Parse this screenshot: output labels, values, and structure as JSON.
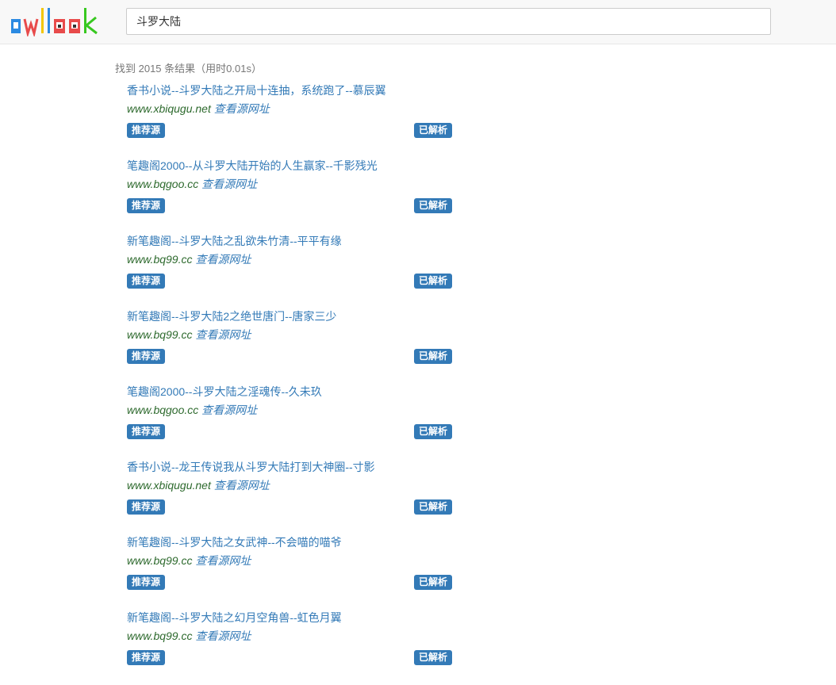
{
  "header": {
    "logo_letters": [
      "o",
      "w",
      "l",
      "l",
      "o",
      "o",
      "k"
    ],
    "logo_colors": [
      "#2b8ae2",
      "#e84b4b",
      "#f2c600",
      "#2b8ae2",
      "#e84b4b",
      "#e84b4b",
      "#38c820"
    ],
    "search_value": "斗罗大陆"
  },
  "summary": {
    "text": "找到 2015 条结果（用时0.01s）"
  },
  "results": [
    {
      "title": "香书小说--斗罗大陆之开局十连抽，系统跑了--慕辰翼",
      "domain": "www.xbiqugu.net",
      "source_link": "查看源网址",
      "badge_left": "推荐源",
      "badge_right": "已解析"
    },
    {
      "title": "笔趣阁2000--从斗罗大陆开始的人生赢家--千影残光",
      "domain": "www.bqgoo.cc",
      "source_link": "查看源网址",
      "badge_left": "推荐源",
      "badge_right": "已解析"
    },
    {
      "title": "新笔趣阁--斗罗大陆之乱欲朱竹清--平平有缘",
      "domain": "www.bq99.cc",
      "source_link": "查看源网址",
      "badge_left": "推荐源",
      "badge_right": "已解析"
    },
    {
      "title": "新笔趣阁--斗罗大陆2之绝世唐门--唐家三少",
      "domain": "www.bq99.cc",
      "source_link": "查看源网址",
      "badge_left": "推荐源",
      "badge_right": "已解析"
    },
    {
      "title": "笔趣阁2000--斗罗大陆之淫魂传--久未玖",
      "domain": "www.bqgoo.cc",
      "source_link": "查看源网址",
      "badge_left": "推荐源",
      "badge_right": "已解析"
    },
    {
      "title": "香书小说--龙王传说我从斗罗大陆打到大神圈--寸影",
      "domain": "www.xbiqugu.net",
      "source_link": "查看源网址",
      "badge_left": "推荐源",
      "badge_right": "已解析"
    },
    {
      "title": "新笔趣阁--斗罗大陆之女武神--不会喵的喵爷",
      "domain": "www.bq99.cc",
      "source_link": "查看源网址",
      "badge_left": "推荐源",
      "badge_right": "已解析"
    },
    {
      "title": "新笔趣阁--斗罗大陆之幻月空角兽--虹色月翼",
      "domain": "www.bq99.cc",
      "source_link": "查看源网址",
      "badge_left": "推荐源",
      "badge_right": "已解析"
    }
  ]
}
